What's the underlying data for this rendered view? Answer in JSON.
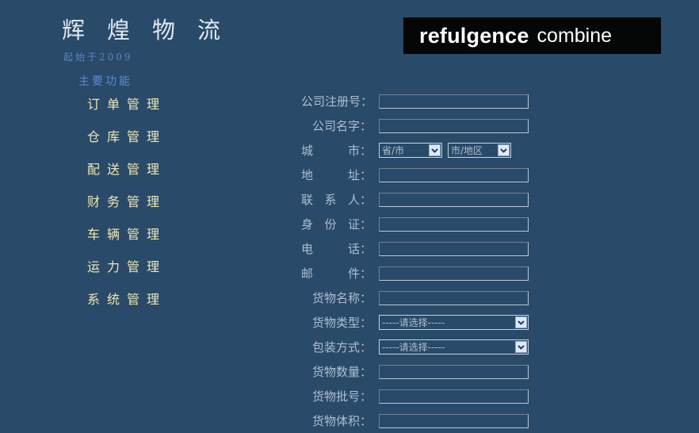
{
  "brand": {
    "title": "辉煌物流",
    "subtitle": "起始于2009",
    "logo_bold": "refulgence",
    "logo_light": "combine"
  },
  "nav": {
    "heading": "主要功能",
    "items": [
      {
        "label": "订单管理"
      },
      {
        "label": "仓库管理"
      },
      {
        "label": "配送管理"
      },
      {
        "label": "财务管理"
      },
      {
        "label": "车辆管理"
      },
      {
        "label": "运力管理"
      },
      {
        "label": "系统管理"
      }
    ]
  },
  "form": {
    "company_reg_no": {
      "label": "公司注册号：",
      "value": ""
    },
    "company_name": {
      "label": "公司名字：",
      "value": ""
    },
    "city": {
      "label_parts": [
        "城",
        "市："
      ],
      "province_select": "省/市",
      "district_select": "市/地区"
    },
    "address": {
      "label_parts": [
        "地",
        "址："
      ],
      "value": ""
    },
    "contact": {
      "label_parts": [
        "联",
        "系",
        "人："
      ],
      "value": ""
    },
    "id_card": {
      "label_parts": [
        "身",
        "份",
        "证："
      ],
      "value": ""
    },
    "phone": {
      "label_parts": [
        "电",
        "话："
      ],
      "value": ""
    },
    "mail": {
      "label_parts": [
        "邮",
        "件："
      ],
      "value": ""
    },
    "goods_name": {
      "label": "货物名称：",
      "value": ""
    },
    "goods_type": {
      "label": "货物类型：",
      "selected": "-----请选择-----"
    },
    "packing": {
      "label": "包装方式：",
      "selected": "-----请选择-----"
    },
    "goods_quantity": {
      "label": "货物数量：",
      "value": ""
    },
    "goods_batch": {
      "label": "货物批号：",
      "value": ""
    },
    "goods_volume": {
      "label": "货物体积：",
      "value": ""
    }
  },
  "colors": {
    "background": "#294a68",
    "nav_text": "#f0e8b7",
    "label_text": "#aebfd2",
    "heading_blue": "#5a8bd6"
  }
}
